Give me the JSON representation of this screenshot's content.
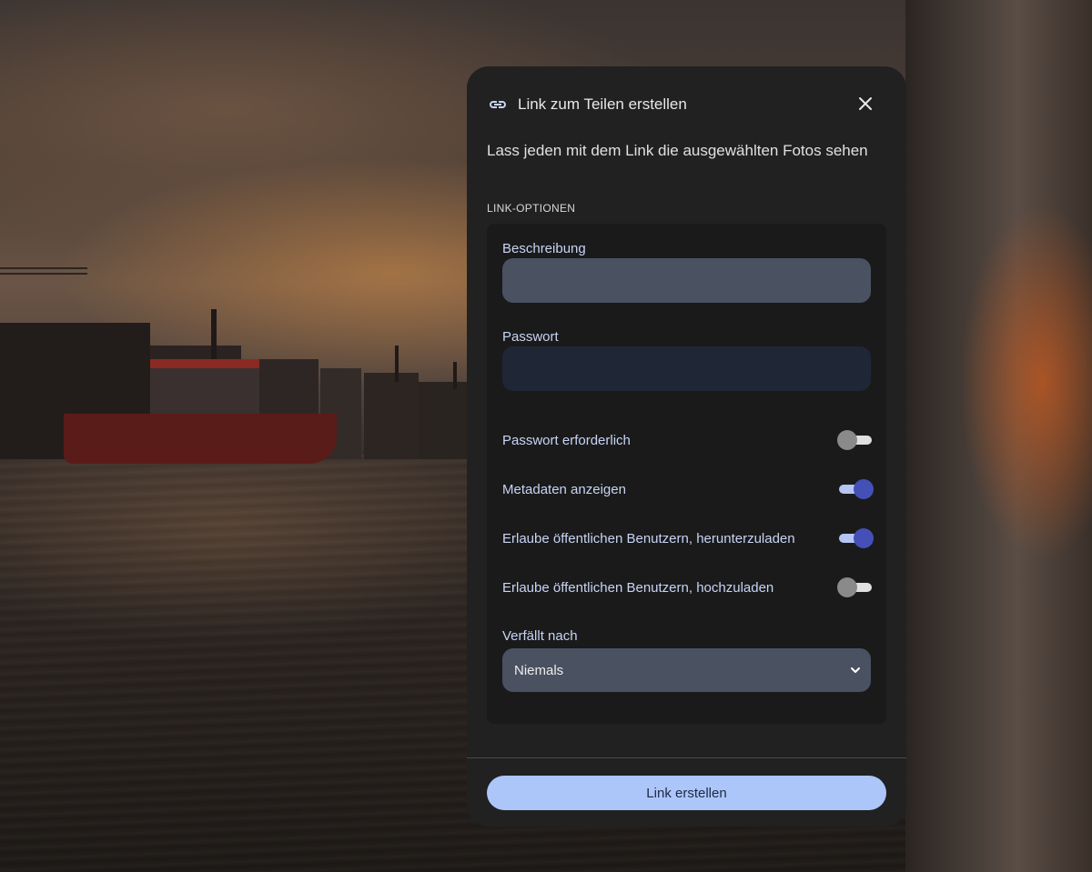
{
  "dialog": {
    "title": "Link zum Teilen erstellen",
    "subtitle": "Lass jeden mit dem Link die ausgewählten Fotos sehen",
    "section_label": "LINK-OPTIONEN",
    "icons": {
      "title": "link-icon",
      "close": "close-icon",
      "select": "chevron-down-icon"
    }
  },
  "fields": {
    "description": {
      "label": "Beschreibung",
      "value": "",
      "placeholder": ""
    },
    "password": {
      "label": "Passwort",
      "value": "",
      "placeholder": ""
    }
  },
  "toggles": [
    {
      "label": "Passwort erforderlich",
      "on": false
    },
    {
      "label": "Metadaten anzeigen",
      "on": true
    },
    {
      "label": "Erlaube öffentlichen Benutzern, herunterzuladen",
      "on": true
    },
    {
      "label": "Erlaube öffentlichen Benutzern, hochzuladen",
      "on": false
    }
  ],
  "expiry": {
    "label": "Verfällt nach",
    "selected": "Niemals"
  },
  "actions": {
    "create_label": "Link erstellen"
  },
  "colors": {
    "accent": "#4450b8",
    "button": "#adc6fa",
    "label": "#c8d4f5",
    "dialog_bg": "#212121"
  }
}
